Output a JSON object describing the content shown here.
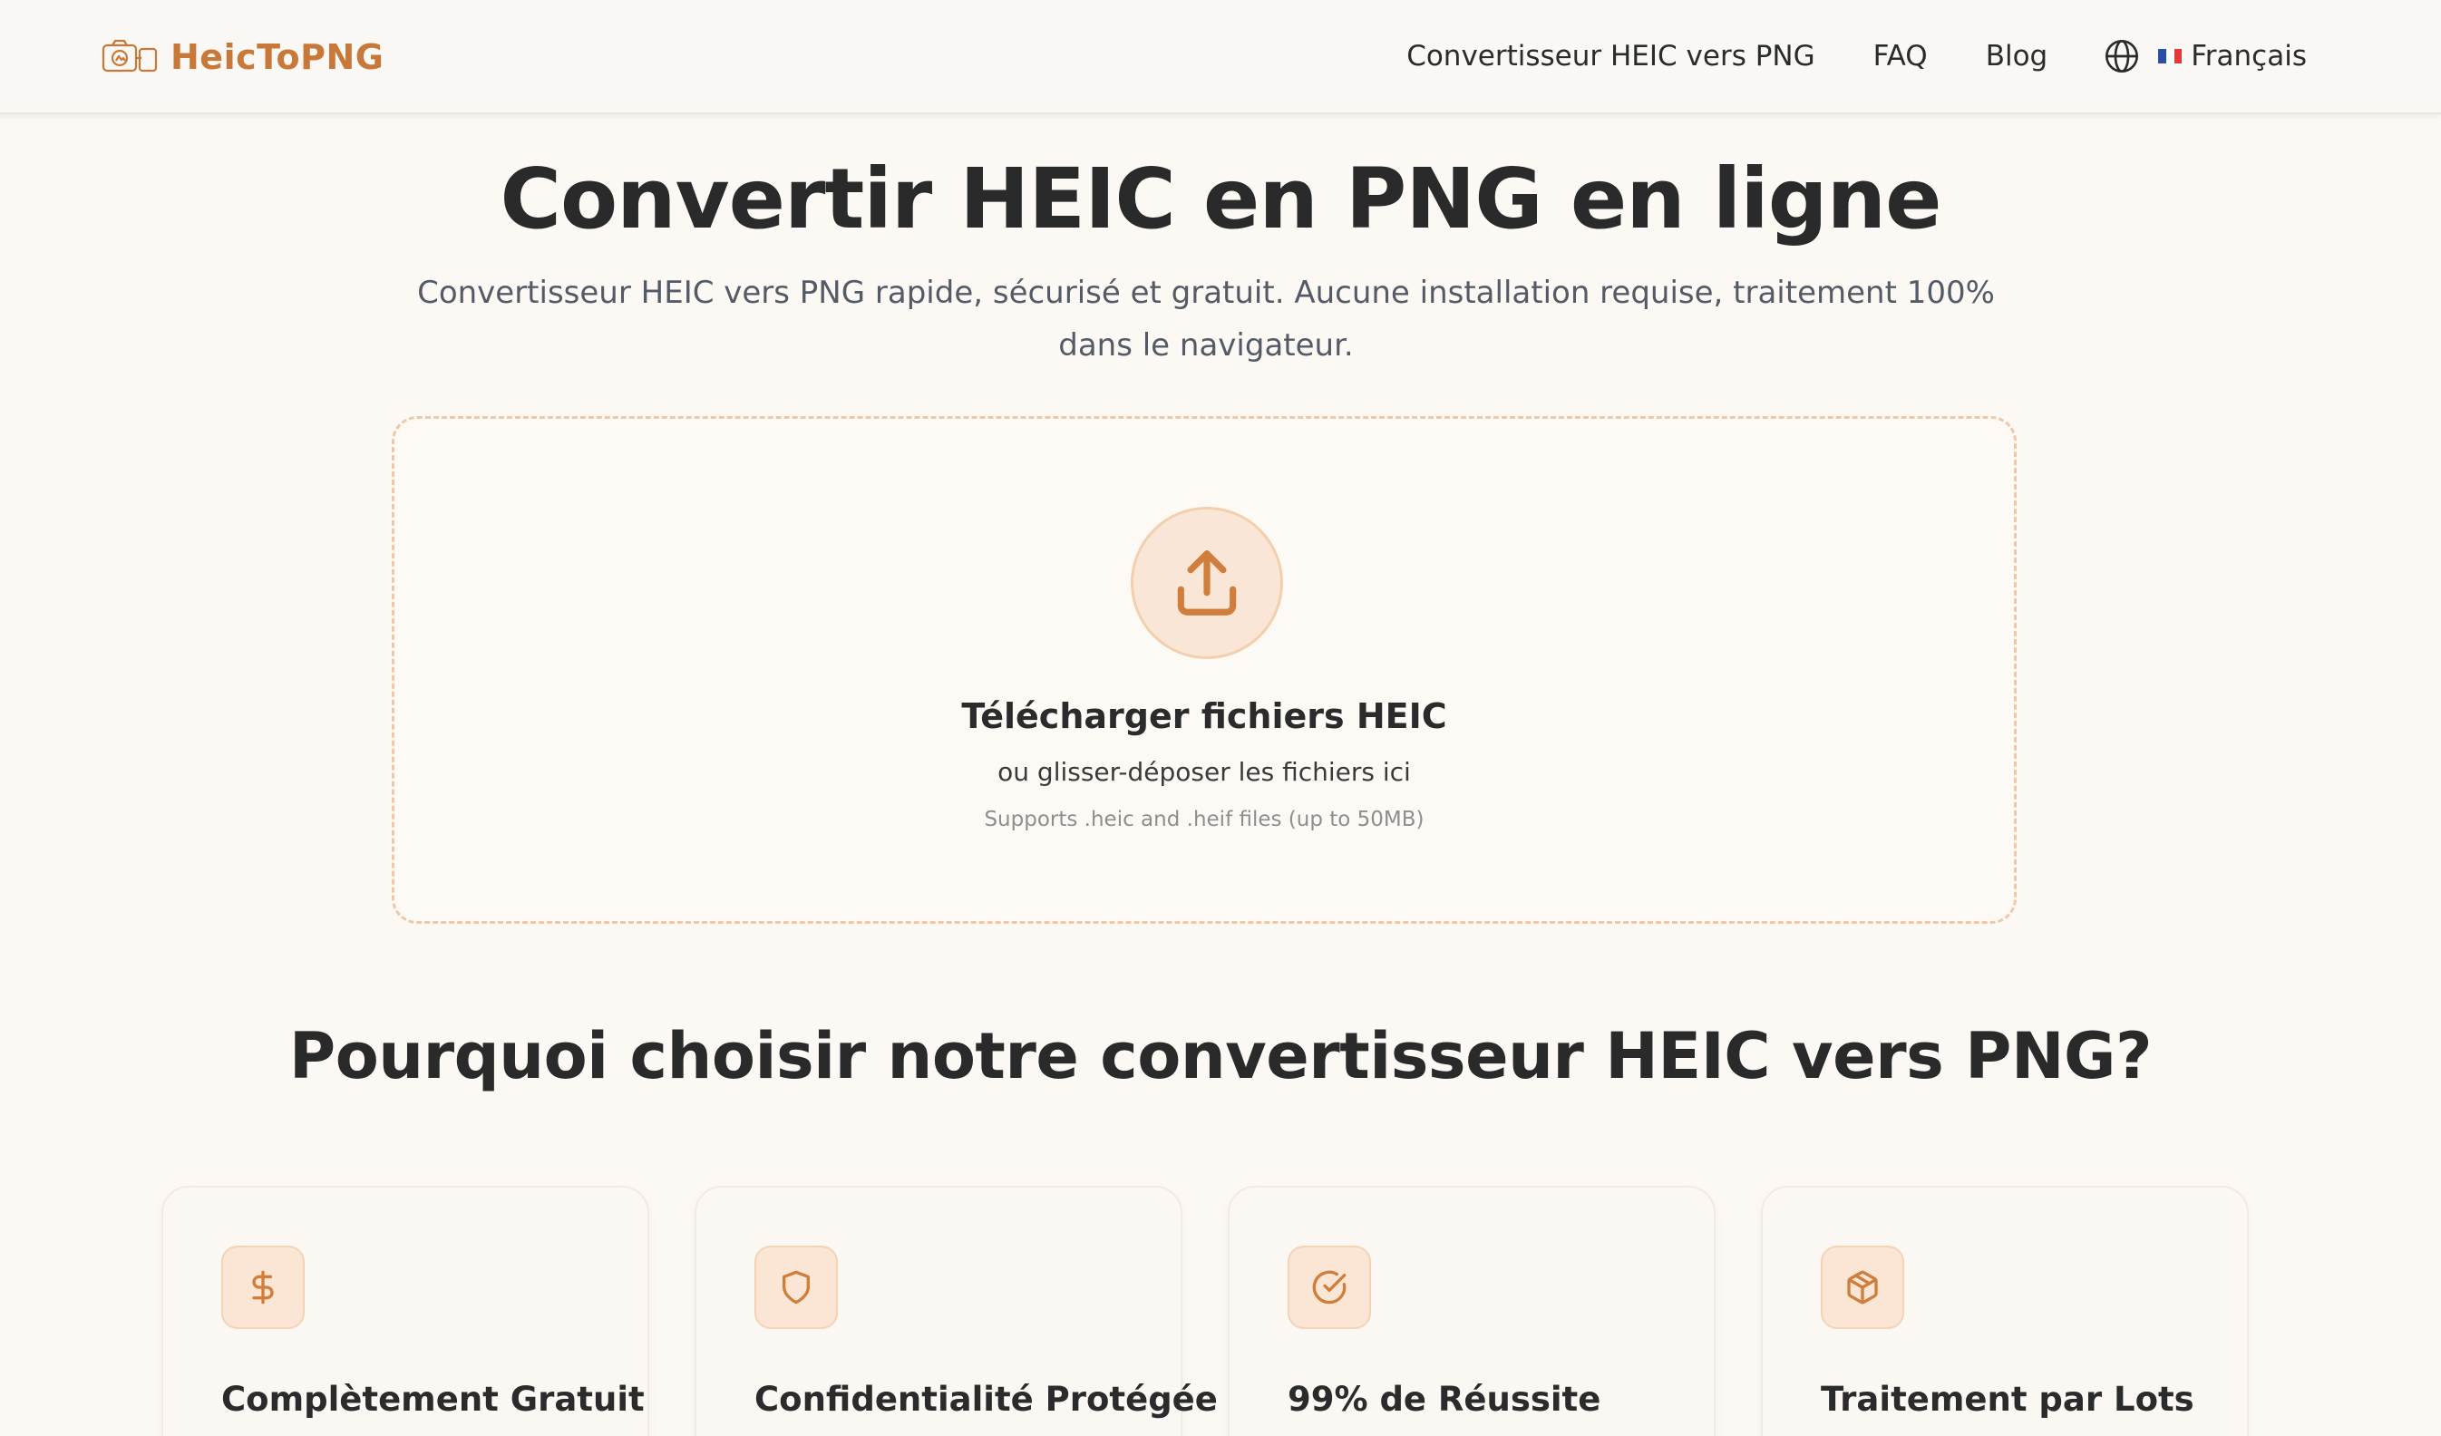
{
  "header": {
    "logo_text": "HeicToPNG",
    "nav": {
      "converter": "Convertisseur HEIC vers PNG",
      "faq": "FAQ",
      "blog": "Blog",
      "language": "Français"
    }
  },
  "hero": {
    "title": "Convertir HEIC en PNG en ligne",
    "subtitle": "Convertisseur HEIC vers PNG rapide, sécurisé et gratuit. Aucune installation requise, traitement 100% dans le navigateur."
  },
  "dropzone": {
    "title": "Télécharger fichiers HEIC",
    "subtitle": "ou glisser-déposer les fichiers ici",
    "note": "Supports .heic and .heif files (up to 50MB)"
  },
  "why": {
    "title": "Pourquoi choisir notre convertisseur HEIC vers PNG?",
    "cards": [
      {
        "icon": "dollar-icon",
        "title": "Complètement Gratuit"
      },
      {
        "icon": "shield-icon",
        "title": "Confidentialité Protégée"
      },
      {
        "icon": "check-circle-icon",
        "title": "99% de Réussite"
      },
      {
        "icon": "package-icon",
        "title": "Traitement par Lots"
      }
    ]
  },
  "colors": {
    "accent": "#c8793a",
    "background": "#fcf9f5",
    "icon_tint": "#fbe6d5"
  }
}
